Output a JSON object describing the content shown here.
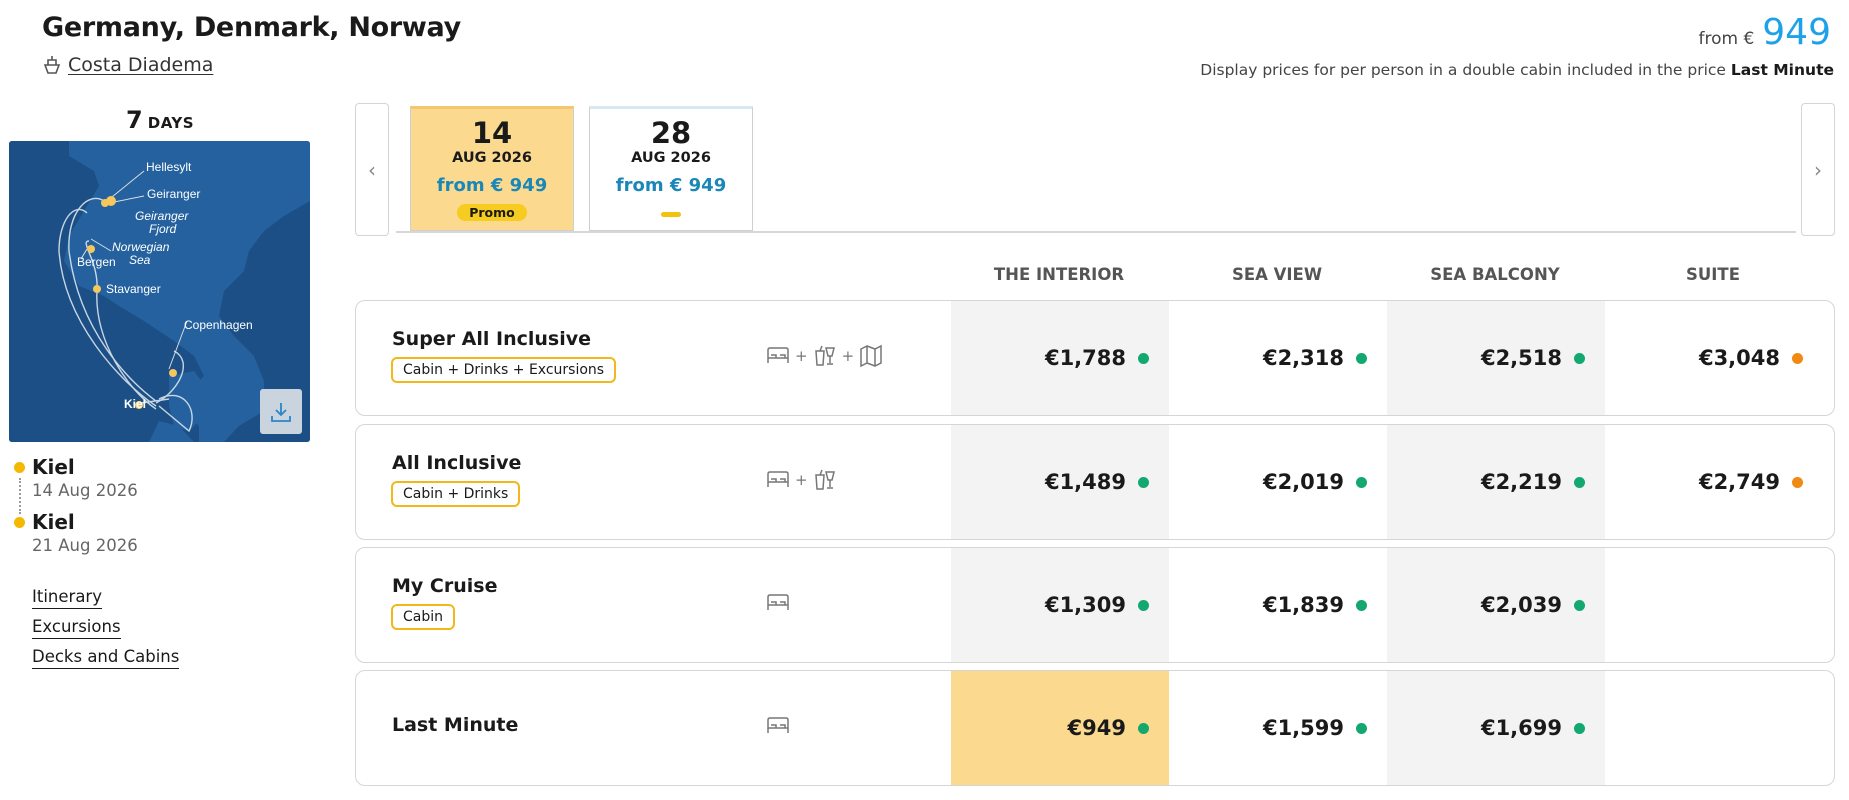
{
  "header": {
    "title": "Germany, Denmark, Norway",
    "ship_name": "Costa Diadema",
    "from_label": "from €",
    "from_price": "949",
    "display_note": "Display prices for per person in a double cabin included in the price",
    "display_note_bold": "Last Minute"
  },
  "itinerary": {
    "days_number": "7",
    "days_label": "DAYS",
    "map_labels": [
      "Hellesylt",
      "Geiranger",
      "Geiranger",
      "Fjord",
      "Norwegian",
      "Sea",
      "Bergen",
      "Stavanger",
      "Copenhagen",
      "Kiel"
    ],
    "ports": [
      {
        "name": "Kiel",
        "date": "14 Aug 2026"
      },
      {
        "name": "Kiel",
        "date": "21 Aug 2026"
      }
    ],
    "links": [
      "Itinerary",
      "Excursions",
      "Decks and Cabins"
    ]
  },
  "date_nav": {
    "prev_icon": "chevron-left-icon",
    "next_icon": "chevron-right-icon",
    "prev_glyph": "‹",
    "next_glyph": "›"
  },
  "dates": [
    {
      "day": "14",
      "month": "AUG 2026",
      "price": "from € 949",
      "badge": "Promo",
      "active": true
    },
    {
      "day": "28",
      "month": "AUG 2026",
      "price": "from € 949",
      "badge": "",
      "active": false
    }
  ],
  "table": {
    "columns": [
      "THE INTERIOR",
      "SEA VIEW",
      "SEA BALCONY",
      "SUITE"
    ],
    "rows": [
      {
        "name": "Super All Inclusive",
        "tag": "Cabin + Drinks + Excursions",
        "icons": [
          "bed-icon",
          "drinks-icon",
          "map-icon"
        ],
        "plus": "+",
        "prices": [
          "€1,788",
          "€2,318",
          "€2,518",
          "€3,048"
        ],
        "status": [
          "green",
          "green",
          "green",
          "orange"
        ]
      },
      {
        "name": "All Inclusive",
        "tag": "Cabin + Drinks",
        "icons": [
          "bed-icon",
          "drinks-icon"
        ],
        "plus": "+",
        "prices": [
          "€1,489",
          "€2,019",
          "€2,219",
          "€2,749"
        ],
        "status": [
          "green",
          "green",
          "green",
          "orange"
        ]
      },
      {
        "name": "My Cruise",
        "tag": "Cabin",
        "icons": [
          "bed-icon"
        ],
        "plus": "",
        "prices": [
          "€1,309",
          "€1,839",
          "€2,039"
        ],
        "status": [
          "green",
          "green",
          "green"
        ]
      },
      {
        "name": "Last Minute",
        "tag": "",
        "icons": [
          "bed-icon"
        ],
        "plus": "",
        "prices": [
          "€949",
          "€1,599",
          "€1,699"
        ],
        "status": [
          "green",
          "green",
          "green"
        ]
      }
    ]
  },
  "colors": {
    "accent_blue": "#1da1e8",
    "highlight_yellow": "#fbd98f",
    "status_green": "#12a870",
    "status_orange": "#f08a12",
    "map_sea": "#1b4f86"
  }
}
